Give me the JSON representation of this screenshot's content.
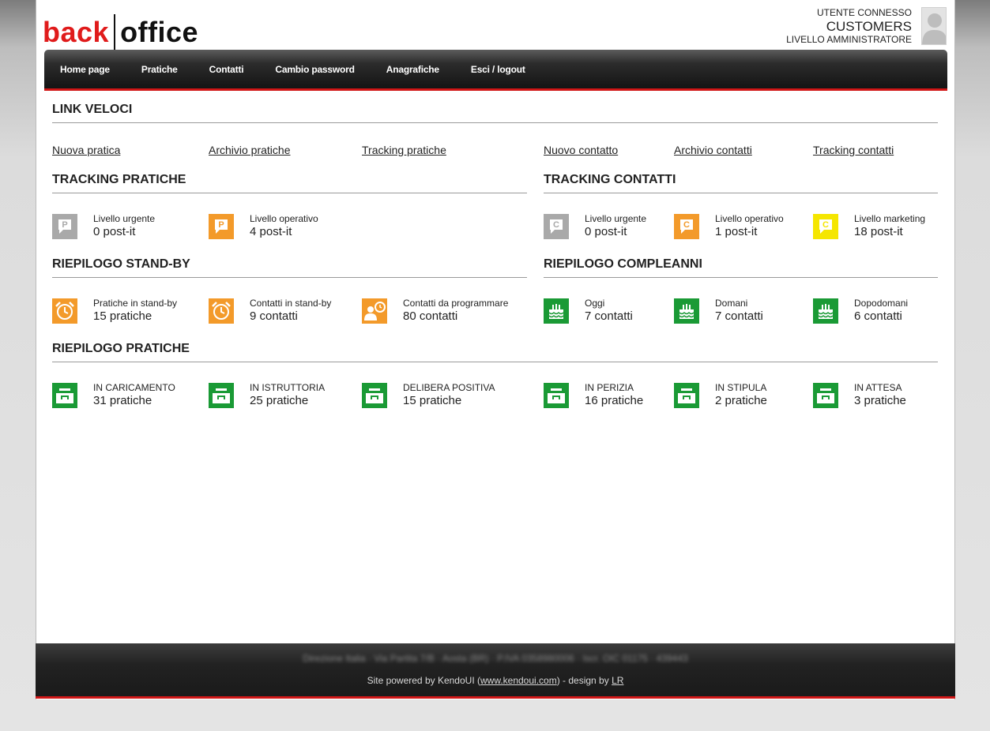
{
  "logo": {
    "back": "back",
    "office": "office"
  },
  "user": {
    "line1": "UTENTE CONNESSO",
    "line2": "CUSTOMERS",
    "line3": "LIVELLO AMMINISTRATORE"
  },
  "nav": [
    "Home page",
    "Pratiche",
    "Contatti",
    "Cambio password",
    "Anagrafiche",
    "Esci / logout"
  ],
  "quick_links": {
    "title": "LINK VELOCI",
    "items": [
      "Nuova pratica",
      "Archivio pratiche",
      "Tracking pratiche",
      "Nuovo contatto",
      "Archivio contatti",
      "Tracking contatti"
    ]
  },
  "tracking_pratiche": {
    "title": "TRACKING PRATICHE",
    "items": [
      {
        "label": "Livello urgente",
        "value": "0 post-it",
        "icon": "post-it-p-icon",
        "color": "#a9a9a9"
      },
      {
        "label": "Livello operativo",
        "value": "4 post-it",
        "icon": "post-it-p-icon",
        "color": "#f39a2a"
      }
    ]
  },
  "tracking_contatti": {
    "title": "TRACKING CONTATTI",
    "items": [
      {
        "label": "Livello urgente",
        "value": "0 post-it",
        "icon": "post-it-c-icon",
        "color": "#a9a9a9"
      },
      {
        "label": "Livello operativo",
        "value": "1 post-it",
        "icon": "post-it-c-icon",
        "color": "#f39a2a"
      },
      {
        "label": "Livello marketing",
        "value": "18 post-it",
        "icon": "post-it-c-icon",
        "color": "#f5e600"
      }
    ]
  },
  "standby": {
    "title": "RIEPILOGO STAND-BY",
    "items": [
      {
        "label": "Pratiche in stand-by",
        "value": "15 pratiche",
        "icon": "alarm-clock-icon",
        "color": "#f39a2a"
      },
      {
        "label": "Contatti in stand-by",
        "value": "9 contatti",
        "icon": "alarm-clock-icon",
        "color": "#f39a2a"
      },
      {
        "label": "Contatti da programmare",
        "value": "80 contatti",
        "icon": "user-schedule-icon",
        "color": "#f39a2a"
      }
    ]
  },
  "compleanni": {
    "title": "RIEPILOGO COMPLEANNI",
    "items": [
      {
        "label": "Oggi",
        "value": "7 contatti",
        "icon": "birthday-cake-icon",
        "color": "#1a9a35"
      },
      {
        "label": "Domani",
        "value": "7 contatti",
        "icon": "birthday-cake-icon",
        "color": "#1a9a35"
      },
      {
        "label": "Dopodomani",
        "value": "6 contatti",
        "icon": "birthday-cake-icon",
        "color": "#1a9a35"
      }
    ]
  },
  "pratiche": {
    "title": "RIEPILOGO PRATICHE",
    "items": [
      {
        "label": "IN CARICAMENTO",
        "value": "31 pratiche",
        "icon": "inbox-tray-icon",
        "color": "#1a9a35"
      },
      {
        "label": "IN ISTRUTTORIA",
        "value": "25 pratiche",
        "icon": "inbox-tray-icon",
        "color": "#1a9a35"
      },
      {
        "label": "DELIBERA POSITIVA",
        "value": "15 pratiche",
        "icon": "inbox-tray-icon",
        "color": "#1a9a35"
      },
      {
        "label": "IN PERIZIA",
        "value": "16 pratiche",
        "icon": "inbox-tray-icon",
        "color": "#1a9a35"
      },
      {
        "label": "IN STIPULA",
        "value": "2 pratiche",
        "icon": "inbox-tray-icon",
        "color": "#1a9a35"
      },
      {
        "label": "IN ATTESA",
        "value": "3 pratiche",
        "icon": "inbox-tray-icon",
        "color": "#1a9a35"
      }
    ]
  },
  "footer": {
    "blurred": "Direzione Italia · Via Partita 7/B · Aosta (BR) · P.IVA 0358980006 · Iscr. OIC 01175 · 439443",
    "credits_prefix": "Site powered by KendoUI (",
    "credits_link": "www.kendoui.com",
    "credits_mid": ") - design by ",
    "credits_author": "LR"
  },
  "colors": {
    "accent_red": "#d01616",
    "orange": "#f39a2a",
    "green": "#1a9a35",
    "gray": "#a9a9a9",
    "yellow": "#f5e600"
  }
}
